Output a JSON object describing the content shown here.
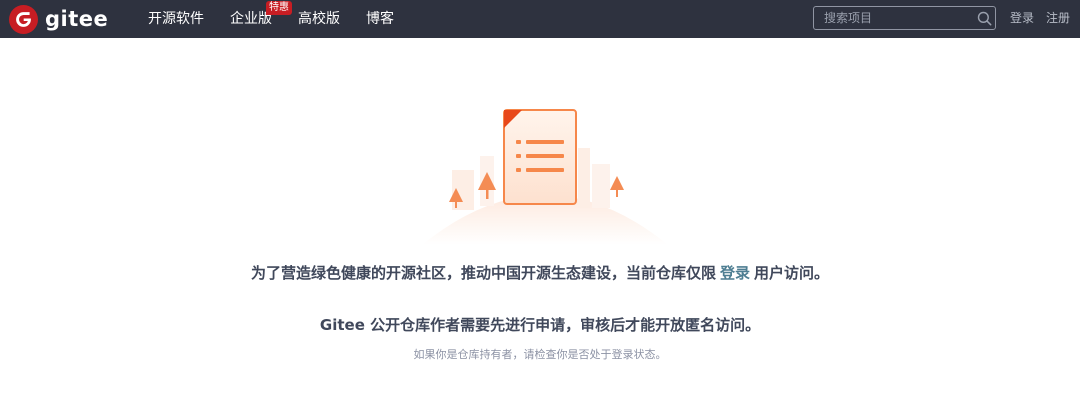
{
  "brand": {
    "name": "gitee",
    "color": "#c71d23"
  },
  "nav": {
    "items": [
      {
        "label": "开源软件"
      },
      {
        "label": "企业版",
        "badge": "特惠"
      },
      {
        "label": "高校版"
      },
      {
        "label": "博客"
      }
    ]
  },
  "search": {
    "placeholder": "搜索项目",
    "icon": "search-icon"
  },
  "auth": {
    "login": "登录",
    "register": "注册"
  },
  "message": {
    "line1_before": "为了营造绿色健康的开源社区，推动中国开源生态建设，当前仓库仅限",
    "line1_link": "登录",
    "line1_after": "用户访问。",
    "line2": "Gitee 公开仓库作者需要先进行申请，审核后才能开放匿名访问。",
    "hint": "如果你是仓库持有者，请检查你是否处于登录状态。"
  },
  "colors": {
    "navbar_bg": "#2e323f",
    "link": "#4e7e92",
    "accent_orange": "#f6874a"
  }
}
